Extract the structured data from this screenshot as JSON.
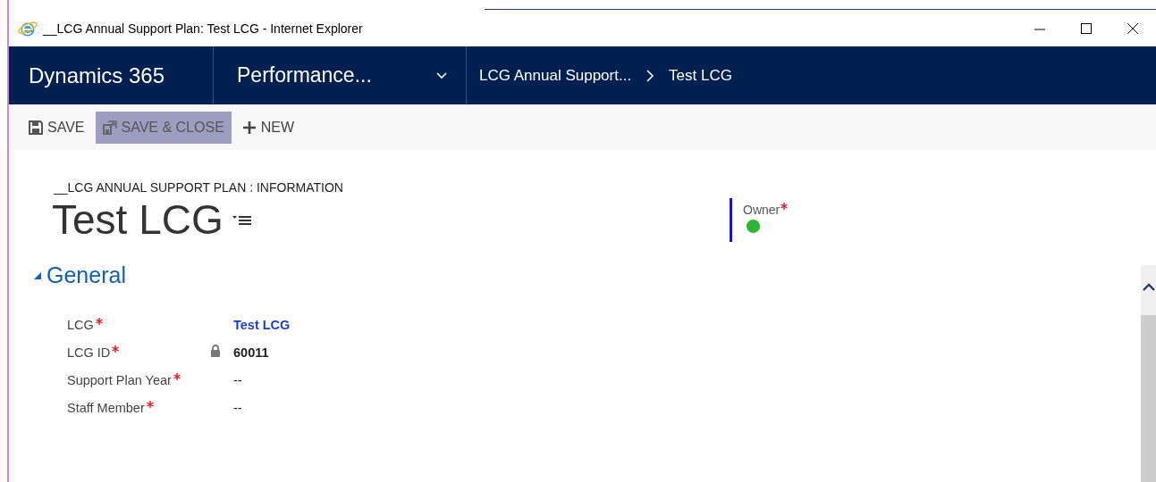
{
  "window": {
    "title": "__LCG Annual Support Plan: Test LCG - Internet Explorer"
  },
  "nav": {
    "app": "Dynamics 365",
    "area": "Performance...",
    "breadcrumb": [
      "LCG Annual Support...",
      "Test LCG"
    ]
  },
  "commands": [
    {
      "label": "SAVE",
      "highlighted": false
    },
    {
      "label": "SAVE & CLOSE",
      "highlighted": true
    },
    {
      "label": "NEW",
      "highlighted": false
    }
  ],
  "form": {
    "entity": "__LCG ANNUAL SUPPORT PLAN : INFORMATION",
    "title": "Test LCG",
    "header_fields": [
      {
        "label": "Owner",
        "required": true,
        "color": "#2fb52f"
      }
    ],
    "sections": [
      {
        "title": "General",
        "expanded": true,
        "fields": [
          {
            "label": "LCG",
            "required": true,
            "value": "Test LCG",
            "kind": "link",
            "locked": false
          },
          {
            "label": "LCG ID",
            "required": true,
            "value": "60011",
            "kind": "text",
            "locked": true
          },
          {
            "label": "Support Plan Year",
            "required": true,
            "value": "--",
            "kind": "text",
            "locked": false
          },
          {
            "label": "Staff Member",
            "required": true,
            "value": "--",
            "kind": "text",
            "locked": false
          }
        ]
      }
    ]
  }
}
